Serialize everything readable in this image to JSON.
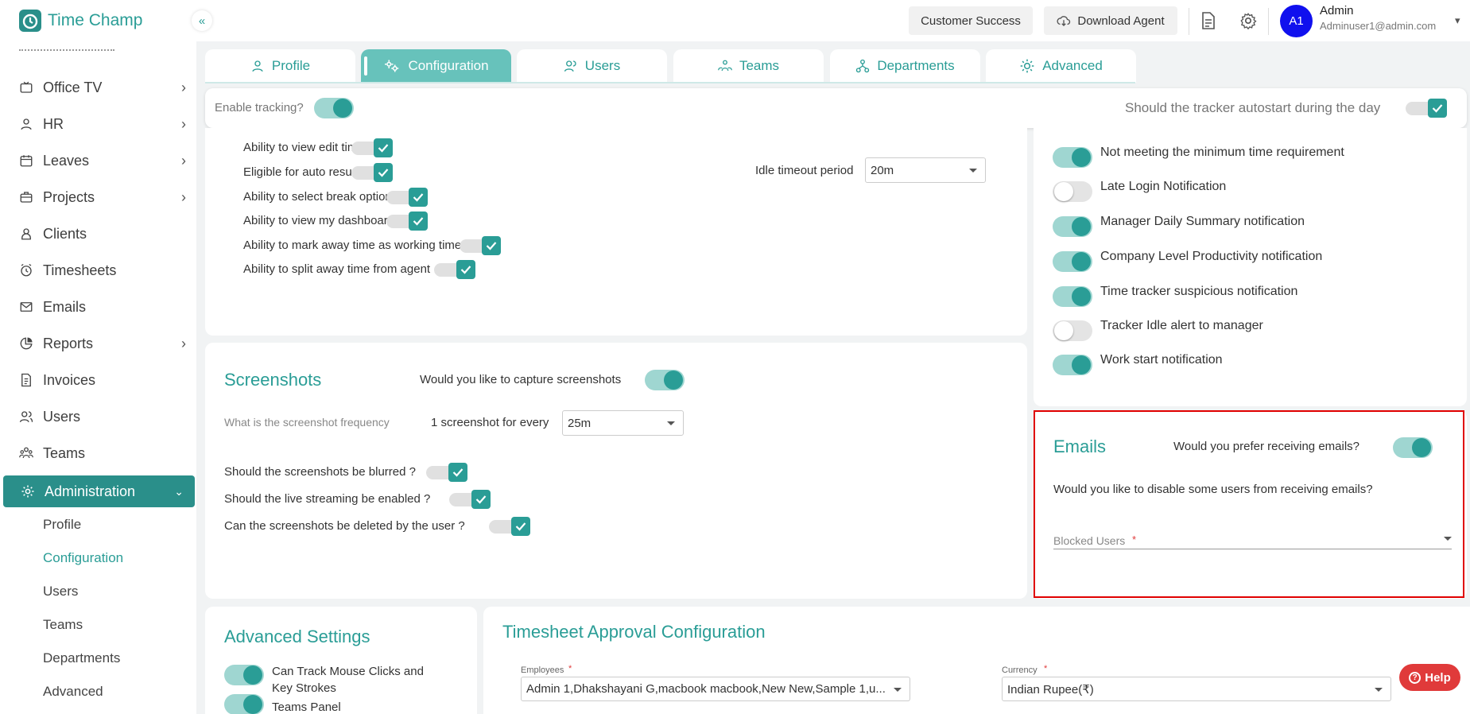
{
  "app": {
    "name": "Time Champ"
  },
  "sidebar": {
    "items": [
      {
        "label": "Office TV",
        "icon": "tv-icon",
        "has_children": true
      },
      {
        "label": "HR",
        "icon": "person-icon",
        "has_children": true
      },
      {
        "label": "Leaves",
        "icon": "calendar-icon",
        "has_children": true
      },
      {
        "label": "Projects",
        "icon": "briefcase-icon",
        "has_children": true
      },
      {
        "label": "Clients",
        "icon": "client-icon",
        "has_children": false
      },
      {
        "label": "Timesheets",
        "icon": "clock-icon",
        "has_children": false
      },
      {
        "label": "Emails",
        "icon": "mail-icon",
        "has_children": false
      },
      {
        "label": "Reports",
        "icon": "pie-chart-icon",
        "has_children": true
      },
      {
        "label": "Invoices",
        "icon": "invoice-icon",
        "has_children": false
      },
      {
        "label": "Users",
        "icon": "users-icon",
        "has_children": false
      },
      {
        "label": "Teams",
        "icon": "teams-icon",
        "has_children": false
      }
    ],
    "active": {
      "label": "Administration",
      "icon": "gear-icon"
    },
    "subitems": [
      "Profile",
      "Configuration",
      "Users",
      "Teams",
      "Departments",
      "Advanced"
    ],
    "active_sub": "Configuration"
  },
  "topbar": {
    "customer_success": "Customer Success",
    "download_agent": "Download Agent",
    "user": {
      "initials": "A1",
      "name": "Admin",
      "email": "Adminuser1@admin.com"
    }
  },
  "tabs": [
    "Profile",
    "Configuration",
    "Users",
    "Teams",
    "Departments",
    "Advanced"
  ],
  "active_tab": "Configuration",
  "tracking": {
    "enable_label": "Enable tracking?",
    "enable_on": true,
    "autostart_label": "Should the tracker autostart during the day",
    "autostart_checked": true
  },
  "permissions": [
    {
      "label": "Ability to view edit time",
      "checked": true
    },
    {
      "label": "Eligible for auto resume",
      "checked": true
    },
    {
      "label": "Ability to select break options",
      "checked": true
    },
    {
      "label": "Ability to view my dashboard",
      "checked": true
    },
    {
      "label": "Ability to mark away time as working time",
      "checked": true
    },
    {
      "label": "Ability to split away time from agent",
      "checked": true
    }
  ],
  "idle": {
    "label": "Idle timeout period",
    "value": "20m"
  },
  "notifications": [
    {
      "label": "Not meeting the minimum time requirement",
      "on": true
    },
    {
      "label": "Late Login Notification",
      "on": false
    },
    {
      "label": "Manager Daily Summary notification",
      "on": true
    },
    {
      "label": "Company Level Productivity notification",
      "on": true
    },
    {
      "label": "Time tracker suspicious notification",
      "on": true
    },
    {
      "label": "Tracker Idle alert to manager",
      "on": false
    },
    {
      "label": "Work start notification",
      "on": true
    }
  ],
  "screenshots": {
    "title": "Screenshots",
    "capture_label": "Would you like to capture screenshots",
    "capture_on": true,
    "frequency_label": "What is the screenshot frequency",
    "every_label": "1 screenshot for every",
    "every_value": "25m",
    "options": [
      {
        "label": "Should the screenshots be blurred ?",
        "checked": true
      },
      {
        "label": "Should the live streaming be enabled ?",
        "checked": true
      },
      {
        "label": "Can the screenshots be deleted by the user ?",
        "checked": true
      }
    ]
  },
  "emails": {
    "title": "Emails",
    "prefer_label": "Would you prefer receiving emails?",
    "prefer_on": true,
    "disable_label": "Would you like to disable some users from receiving emails?",
    "blocked_label": "Blocked Users",
    "required_mark": "*"
  },
  "advanced": {
    "title": "Advanced Settings",
    "items": [
      {
        "label": "Can Track Mouse Clicks and Key Strokes",
        "on": true
      },
      {
        "label": "Teams Panel",
        "on": true
      }
    ]
  },
  "timesheet": {
    "title": "Timesheet Approval Configuration",
    "employees_label": "Employees",
    "employees_value": "Admin 1,Dhakshayani G,macbook macbook,New New,Sample 1,u...",
    "currency_label": "Currency",
    "currency_value": "Indian Rupee(₹)",
    "required_mark": "*"
  },
  "help": {
    "label": "Help"
  },
  "colors": {
    "accent": "#2a9d96",
    "accent_dark": "#2a8f8a",
    "highlight": "#e00000",
    "avatar": "#1010ee"
  }
}
